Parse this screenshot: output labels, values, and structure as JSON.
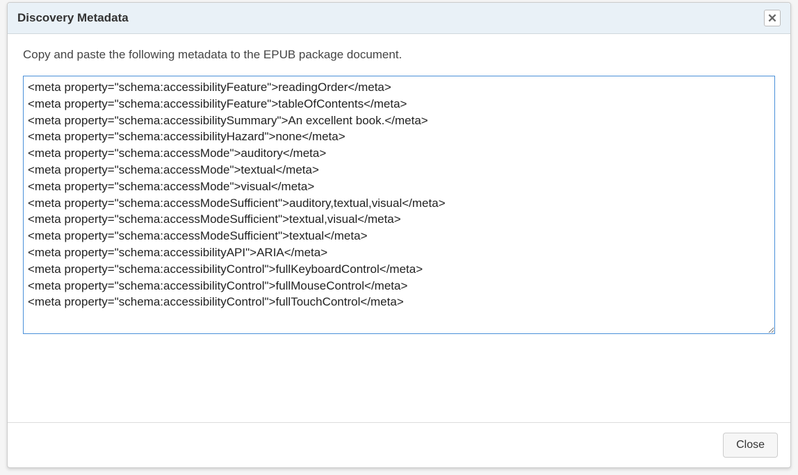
{
  "dialog": {
    "title": "Discovery Metadata",
    "instruction": "Copy and paste the following metadata to the EPUB package document.",
    "close_label": "Close",
    "metadata_text": "<meta property=\"schema:accessibilityFeature\">readingOrder</meta>\n<meta property=\"schema:accessibilityFeature\">tableOfContents</meta>\n<meta property=\"schema:accessibilitySummary\">An excellent book.</meta>\n<meta property=\"schema:accessibilityHazard\">none</meta>\n<meta property=\"schema:accessMode\">auditory</meta>\n<meta property=\"schema:accessMode\">textual</meta>\n<meta property=\"schema:accessMode\">visual</meta>\n<meta property=\"schema:accessModeSufficient\">auditory,textual,visual</meta>\n<meta property=\"schema:accessModeSufficient\">textual,visual</meta>\n<meta property=\"schema:accessModeSufficient\">textual</meta>\n<meta property=\"schema:accessibilityAPI\">ARIA</meta>\n<meta property=\"schema:accessibilityControl\">fullKeyboardControl</meta>\n<meta property=\"schema:accessibilityControl\">fullMouseControl</meta>\n<meta property=\"schema:accessibilityControl\">fullTouchControl</meta>\n"
  }
}
